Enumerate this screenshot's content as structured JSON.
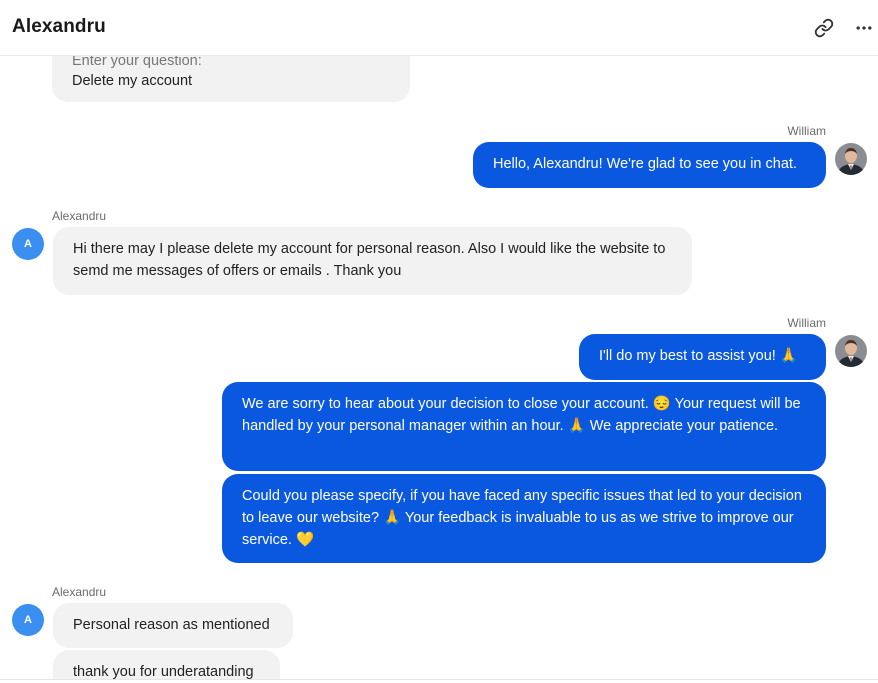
{
  "header": {
    "title": "Alexandru",
    "link_icon": "link-icon",
    "more_icon": "more-horizontal-icon"
  },
  "colors": {
    "outgoing_bubble": "#0a58e0",
    "incoming_bubble": "#f2f2f2",
    "avatar_letter_bg": "#3b8ff0"
  },
  "messages": {
    "m0": {
      "clipped": "Enter your question:",
      "text": "Delete my account"
    },
    "g1": {
      "sender": "William",
      "text": "Hello, Alexandru! We're glad to see you in chat."
    },
    "g2": {
      "sender": "Alexandru",
      "avatar": "A",
      "text": "Hi there may I please delete my account for personal reason. Also I would like the website to semd me messages of offers or emails . Thank you"
    },
    "g3": {
      "sender": "William",
      "texts": [
        "I'll do my best to assist you! 🙏",
        "We are sorry to hear about your decision to close your account. 😔 Your request will be handled by your personal manager within an hour. 🙏 We appreciate your patience.",
        "Could you please specify, if you have faced any specific issues that led to your decision to leave our website? 🙏 Your feedback is invaluable to us as we strive to improve our service. 💛"
      ]
    },
    "g4": {
      "sender": "Alexandru",
      "avatar": "A",
      "texts": [
        "Personal reason as mentioned",
        "thank you for underatanding"
      ]
    }
  }
}
